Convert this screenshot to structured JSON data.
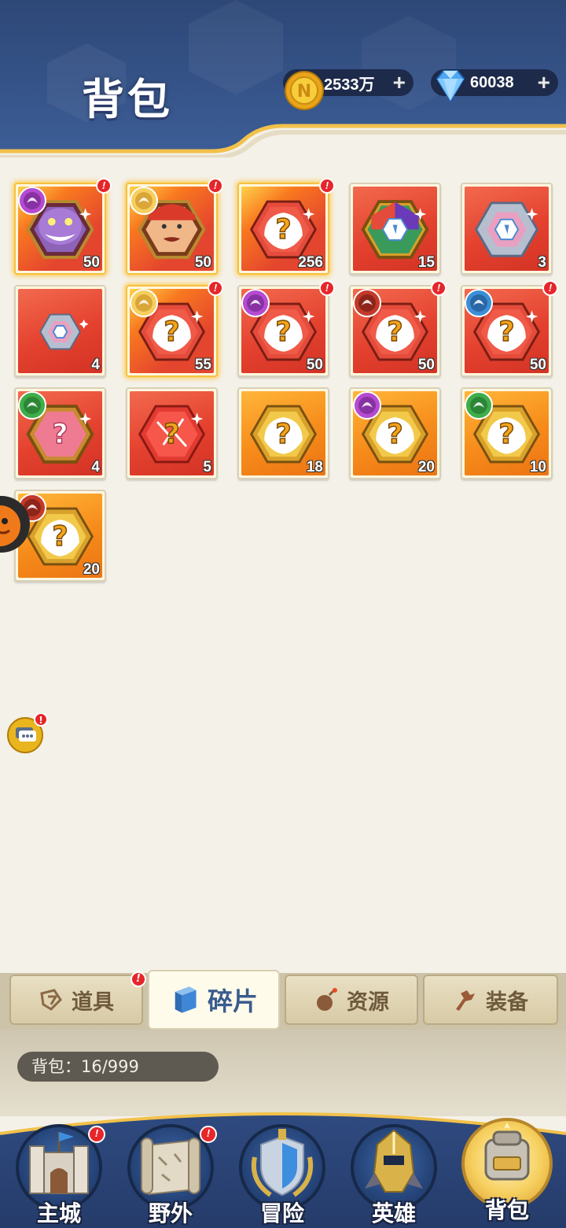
{
  "header": {
    "title": "背包",
    "gold": "2533万",
    "gems": "60038",
    "plus": "+"
  },
  "items": [
    {
      "count": "50",
      "bg": "redgold",
      "art": "monster-portrait",
      "faction": "purple-demon",
      "alert": true
    },
    {
      "count": "50",
      "bg": "redgold",
      "art": "hero-portrait",
      "faction": "gold-light",
      "alert": true
    },
    {
      "count": "256",
      "bg": "redgold",
      "art": "mystery-fragment",
      "faction": "",
      "alert": true
    },
    {
      "count": "15",
      "bg": "red",
      "art": "rainbow-crystal",
      "faction": "",
      "alert": false
    },
    {
      "count": "3",
      "bg": "red",
      "art": "blue-crystal-frame",
      "faction": "",
      "alert": false
    },
    {
      "count": "4",
      "bg": "red",
      "art": "small-crystal",
      "faction": "",
      "alert": false
    },
    {
      "count": "55",
      "bg": "redgold",
      "art": "mystery-fragment",
      "faction": "gold-light",
      "alert": true
    },
    {
      "count": "50",
      "bg": "red",
      "art": "mystery-fragment",
      "faction": "purple-demon",
      "alert": true
    },
    {
      "count": "50",
      "bg": "red",
      "art": "mystery-fragment",
      "faction": "red-beast",
      "alert": true
    },
    {
      "count": "50",
      "bg": "red",
      "art": "mystery-fragment",
      "faction": "blue-knight",
      "alert": true
    },
    {
      "count": "4",
      "bg": "red",
      "art": "pink-mystery-fragment",
      "faction": "green-forest",
      "alert": false
    },
    {
      "count": "5",
      "bg": "red",
      "art": "red-gem-mystery",
      "faction": "",
      "alert": false
    },
    {
      "count": "18",
      "bg": "gold",
      "art": "gold-mystery-fragment",
      "faction": "",
      "alert": false
    },
    {
      "count": "20",
      "bg": "gold",
      "art": "gold-mystery-fragment",
      "faction": "purple-demon",
      "alert": false
    },
    {
      "count": "10",
      "bg": "gold",
      "art": "gold-mystery-fragment",
      "faction": "green-forest",
      "alert": false
    },
    {
      "count": "20",
      "bg": "gold",
      "art": "gold-mystery-fragment",
      "faction": "red-beast",
      "alert": false
    }
  ],
  "tabs": [
    {
      "label": "道具",
      "icon": "item-tag-icon",
      "active": false,
      "alert": true
    },
    {
      "label": "碎片",
      "icon": "fragment-book-icon",
      "active": true,
      "alert": false
    },
    {
      "label": "资源",
      "icon": "resource-bomb-icon",
      "active": false,
      "alert": false
    },
    {
      "label": "装备",
      "icon": "equipment-icon",
      "active": false,
      "alert": false
    }
  ],
  "capacity": "背包：16/999",
  "nav": [
    {
      "label": "主城",
      "icon": "castle-icon",
      "active": false,
      "alert": true
    },
    {
      "label": "野外",
      "icon": "map-scroll-icon",
      "active": false,
      "alert": true
    },
    {
      "label": "冒险",
      "icon": "shield-icon",
      "active": false,
      "alert": false
    },
    {
      "label": "英雄",
      "icon": "knight-helmet-icon",
      "active": false,
      "alert": false
    },
    {
      "label": "背包",
      "icon": "backpack-icon",
      "active": true,
      "alert": false
    }
  ],
  "alert_mark": "!",
  "colors": {
    "header_blue": "#2f4a80",
    "accent_gold": "#f2c14a",
    "alert_red": "#e6262a",
    "active_tab_text": "#3a5b8e"
  }
}
